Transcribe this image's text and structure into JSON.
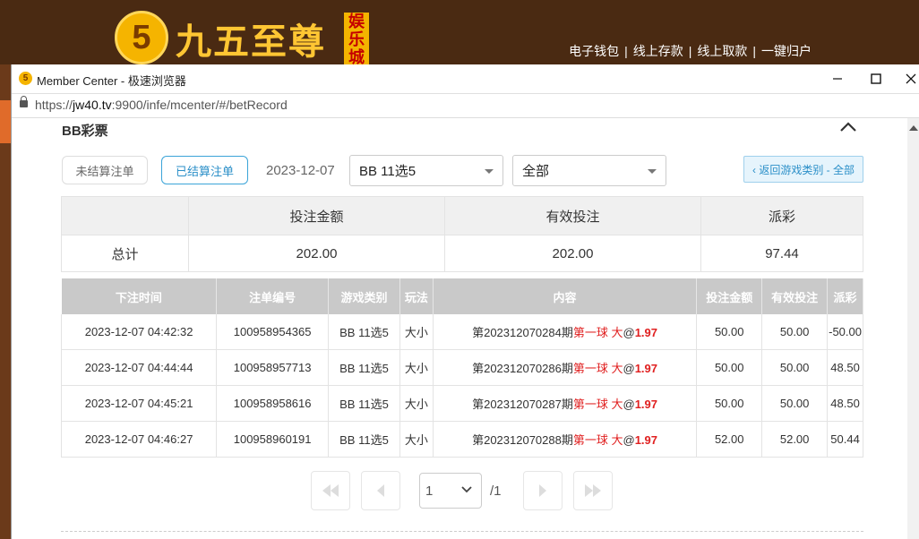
{
  "site": {
    "logo_char": "5",
    "logo_text": "九五至尊",
    "logo_badge": [
      "娱",
      "乐",
      "城"
    ],
    "nav": [
      "电子钱包",
      "线上存款",
      "线上取款",
      "一键归户"
    ],
    "nav_sep": "|"
  },
  "window": {
    "title": "Member Center - 极速浏览器",
    "url_prefix": "https://",
    "url_host": "jw40.tv",
    "url_rest": ":9900/infe/mcenter/#/betRecord"
  },
  "section": {
    "title": "BB彩票"
  },
  "filters": {
    "tab_unsettled": "未结算注单",
    "tab_settled": "已结算注单",
    "date": "2023-12-07",
    "game_select": "BB 11选5",
    "type_select": "全部",
    "back_button": "‹ 返回游戏类别 - 全部"
  },
  "summary": {
    "headers": [
      "",
      "投注金额",
      "有效投注",
      "派彩"
    ],
    "row_label": "总计",
    "bet_amount": "202.00",
    "valid_bet": "202.00",
    "payout": "97.44"
  },
  "records": {
    "headers": [
      "下注时间",
      "注单编号",
      "游戏类别",
      "玩法",
      "内容",
      "投注金额",
      "有效投注",
      "派彩"
    ],
    "rows": [
      {
        "time": "2023-12-07 04:42:32",
        "id": "100958954365",
        "game": "BB 11选5",
        "play": "大小",
        "period": "第202312070284期",
        "pick": "第一球 大",
        "at": "@",
        "odds": "1.97",
        "bet": "50.00",
        "valid": "50.00",
        "payout": "-50.00"
      },
      {
        "time": "2023-12-07 04:44:44",
        "id": "100958957713",
        "game": "BB 11选5",
        "play": "大小",
        "period": "第202312070286期",
        "pick": "第一球 大",
        "at": "@",
        "odds": "1.97",
        "bet": "50.00",
        "valid": "50.00",
        "payout": "48.50"
      },
      {
        "time": "2023-12-07 04:45:21",
        "id": "100958958616",
        "game": "BB 11选5",
        "play": "大小",
        "period": "第202312070287期",
        "pick": "第一球 大",
        "at": "@",
        "odds": "1.97",
        "bet": "50.00",
        "valid": "50.00",
        "payout": "48.50"
      },
      {
        "time": "2023-12-07 04:46:27",
        "id": "100958960191",
        "game": "BB 11选5",
        "play": "大小",
        "period": "第202312070288期",
        "pick": "第一球 大",
        "at": "@",
        "odds": "1.97",
        "bet": "52.00",
        "valid": "52.00",
        "payout": "50.44"
      }
    ]
  },
  "pagination": {
    "current": "1",
    "total": "/1"
  },
  "colors": {
    "accent": "#2b8fc8",
    "negative": "#e02020",
    "header_bg": "#4a2a12"
  }
}
